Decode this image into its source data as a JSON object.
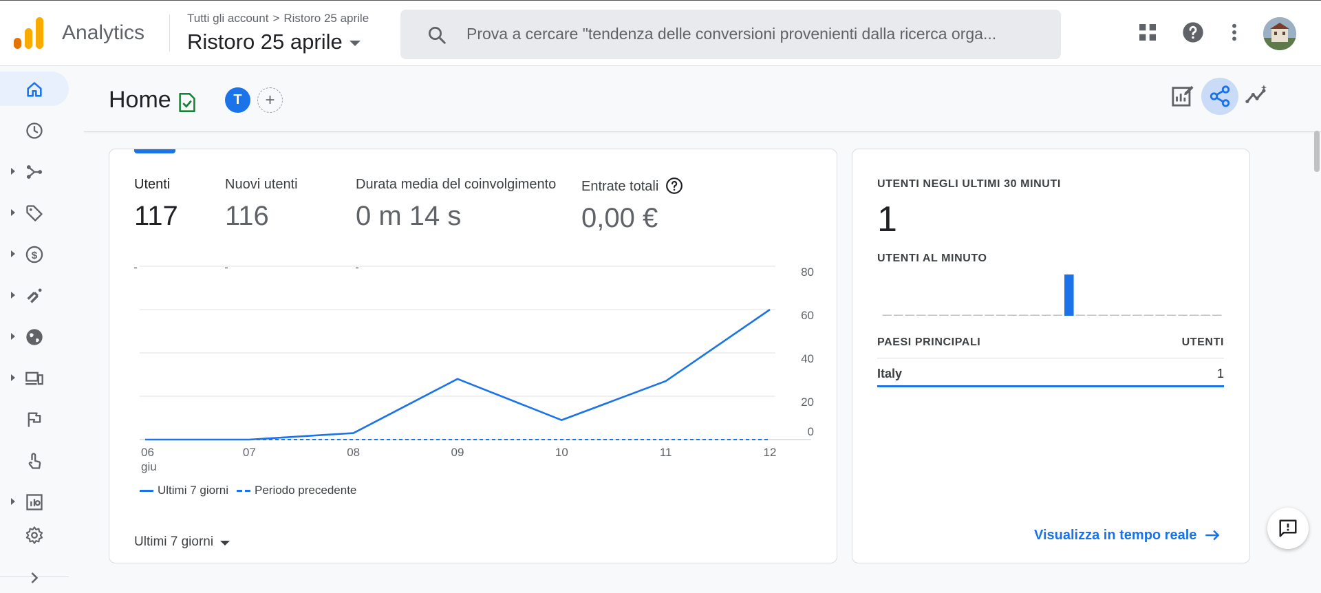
{
  "header": {
    "app_name": "Analytics",
    "breadcrumb": [
      "Tutti gli account",
      "Ristoro 25 aprile"
    ],
    "property_name": "Ristoro 25 aprile",
    "search_placeholder": "Prova a cercare \"tendenza delle conversioni provenienti dalla ricerca orga..."
  },
  "page": {
    "title": "Home",
    "user_initial": "T",
    "add_symbol": "+"
  },
  "sidebar": {
    "items": [
      "home-icon",
      "reports-snapshot-icon",
      "explore-icon",
      "tag-icon",
      "monetization-icon",
      "acquisition-icon",
      "globe-icon",
      "devices-icon",
      "flag-icon",
      "touch-icon",
      "library-icon"
    ],
    "settings_icon": "gear-icon",
    "expand_icon": "chevron-right-icon"
  },
  "metrics": [
    {
      "label": "Utenti",
      "value": "117"
    },
    {
      "label": "Nuovi utenti",
      "value": "116"
    },
    {
      "label": "Durata media del coinvolgimento",
      "value": "0 m 14 s"
    },
    {
      "label": "Entrate totali",
      "value": "0,00 €"
    }
  ],
  "chart_data": {
    "type": "line",
    "x": [
      "06",
      "07",
      "08",
      "09",
      "10",
      "11",
      "12"
    ],
    "x_sublabel": "giu",
    "yticks": [
      0,
      20,
      40,
      60,
      80
    ],
    "ylim": [
      0,
      80
    ],
    "series": [
      {
        "name": "Ultimi 7 giorni",
        "values": [
          0,
          0,
          3,
          28,
          9,
          27,
          60
        ],
        "style": "solid"
      },
      {
        "name": "Periodo precedente",
        "values": [
          0,
          0,
          0,
          0,
          0,
          0,
          0
        ],
        "style": "dashed"
      }
    ],
    "color": "#1a73e8",
    "grid": true
  },
  "period_selector": "Ultimi 7 giorni",
  "realtime": {
    "title": "UTENTI NEGLI ULTIMI 30 MINUTI",
    "value": "1",
    "per_minute_label": "UTENTI AL MINUTO",
    "per_minute_values": [
      0,
      0,
      0,
      0,
      0,
      0,
      0,
      0,
      0,
      0,
      0,
      0,
      0,
      0,
      0,
      0,
      1,
      0,
      0,
      0,
      0,
      0,
      0,
      0,
      0,
      0,
      0,
      0,
      0,
      0
    ],
    "countries_header": "PAESI PRINCIPALI",
    "users_header": "UTENTI",
    "countries": [
      {
        "name": "Italy",
        "users": "1"
      }
    ],
    "link": "Visualizza in tempo reale"
  },
  "colors": {
    "accent": "#1a73e8",
    "logo_orange": "#f9ab00",
    "logo_dark": "#e37400"
  }
}
